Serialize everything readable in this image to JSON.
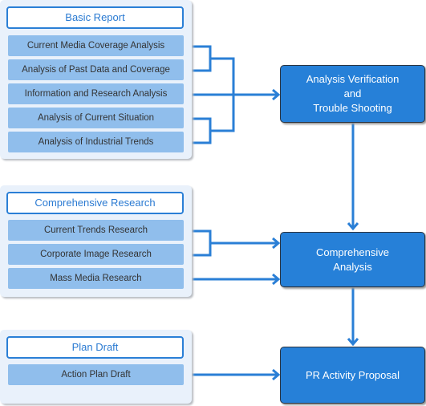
{
  "groups": [
    {
      "title": "Basic Report",
      "items": [
        "Current Media Coverage Analysis",
        "Analysis of Past Data and Coverage",
        "Information and Research Analysis",
        "Analysis of Current Situation",
        "Analysis of Industrial Trends"
      ]
    },
    {
      "title": "Comprehensive Research",
      "items": [
        "Current Trends Research",
        "Corporate Image Research",
        "Mass Media Research"
      ]
    },
    {
      "title": "Plan Draft",
      "items": [
        "Action Plan Draft"
      ]
    }
  ],
  "outputs": [
    {
      "lines": [
        "Analysis Verification",
        "and",
        "Trouble Shooting"
      ]
    },
    {
      "lines": [
        "Comprehensive",
        "Analysis"
      ]
    },
    {
      "lines": [
        "PR Activity Proposal"
      ]
    }
  ],
  "colors": {
    "accent": "#2680d8",
    "panel": "#e9f1fb",
    "item": "#90beec",
    "connector": "#2a7fd6"
  }
}
